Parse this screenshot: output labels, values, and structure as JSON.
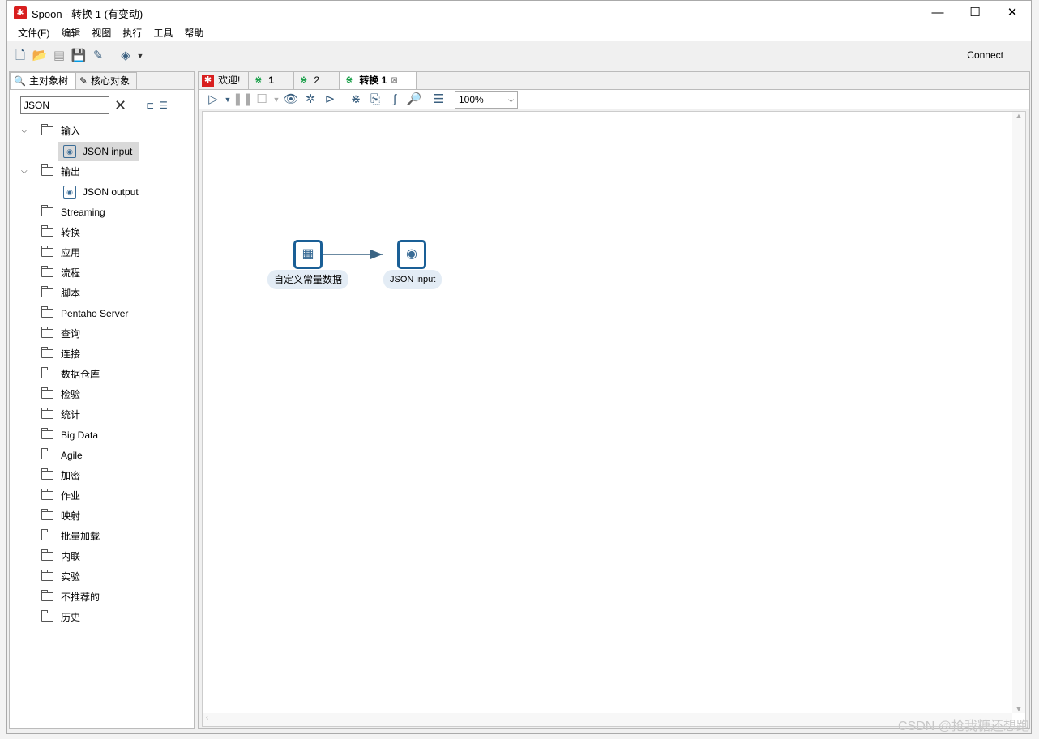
{
  "window": {
    "title": "Spoon - 转换 1 (有变动)",
    "minimize": "—",
    "maximize": "☐",
    "close": "✕"
  },
  "menu": [
    "文件(F)",
    "编辑",
    "视图",
    "执行",
    "工具",
    "帮助"
  ],
  "toolbar": {
    "connect": "Connect"
  },
  "left_tabs": [
    "主对象树",
    "核心对象"
  ],
  "search": {
    "value": "JSON"
  },
  "tree": [
    {
      "label": "输入",
      "expanded": true,
      "children": [
        "JSON input"
      ]
    },
    {
      "label": "输出",
      "expanded": true,
      "children": [
        "JSON output"
      ]
    },
    {
      "label": "Streaming"
    },
    {
      "label": "转换"
    },
    {
      "label": "应用"
    },
    {
      "label": "流程"
    },
    {
      "label": "脚本"
    },
    {
      "label": "Pentaho Server"
    },
    {
      "label": "查询"
    },
    {
      "label": "连接"
    },
    {
      "label": "数据仓库"
    },
    {
      "label": "检验"
    },
    {
      "label": "统计"
    },
    {
      "label": "Big Data"
    },
    {
      "label": "Agile"
    },
    {
      "label": "加密"
    },
    {
      "label": "作业"
    },
    {
      "label": "映射"
    },
    {
      "label": "批量加载"
    },
    {
      "label": "内联"
    },
    {
      "label": "实验"
    },
    {
      "label": "不推荐的"
    },
    {
      "label": "历史"
    }
  ],
  "tabs": [
    "欢迎!",
    "1",
    "2",
    "转换 1"
  ],
  "zoom": "100%",
  "canvas": {
    "nodes": [
      "自定义常量数据",
      "JSON input"
    ]
  },
  "watermark": "CSDN @抢我糖还想跑",
  "colors": {
    "accent": "#1a5f96",
    "spoon_red": "#d81e1e",
    "transform_green": "#1aa04a"
  }
}
